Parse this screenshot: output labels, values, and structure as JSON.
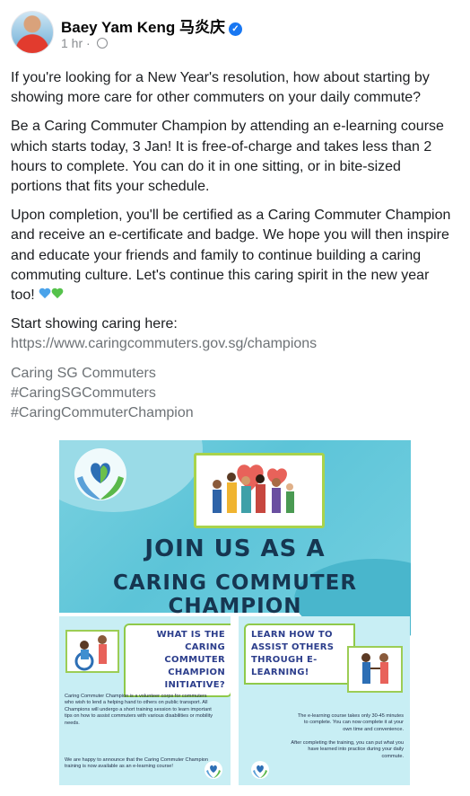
{
  "author": {
    "name": "Baey Yam Keng 马炎庆",
    "time": "1 hr ·"
  },
  "post": {
    "p1": "If you're looking for a New Year's resolution, how about starting by showing more care for other commuters on your daily commute?",
    "p2": "Be a Caring Commuter Champion by attending an e-learning course which starts today, 3 Jan! It is free-of-charge and takes less than 2 hours to complete. You can do it in one sitting, or in bite-sized portions that fits your schedule.",
    "p3": "Upon completion, you'll be certified as a Caring Commuter Champion and receive an e-certificate and badge. We hope you will then inspire and educate your friends and family to continue building a caring commuting culture. Let's continue this caring spirit in the new year too!",
    "p4_label": "Start showing caring here:",
    "p4_link": "https://www.caringcommuters.gov.sg/champions",
    "tags": [
      "Caring SG Commuters",
      "#CaringSGCommuters",
      "#CaringCommuterChampion"
    ]
  },
  "poster": {
    "line1": "JOIN US AS A",
    "line2": "CARING COMMUTER CHAMPION",
    "left": {
      "heading": "WHAT IS THE CARING COMMUTER CHAMPION INITIATIVE?",
      "text1": "Caring Commuter Champion is a volunteer corps for commuters who wish to lend a helping hand to others on public transport. All Champions will undergo a short training session to learn important tips on how to assist commuters with various disabilities or mobility needs.",
      "text2": "We are happy to announce that the Caring Commuter Champion training is now available as an e-learning course!"
    },
    "right": {
      "heading": "LEARN HOW TO ASSIST OTHERS THROUGH E-LEARNING!",
      "text1": "The e-learning course takes only 30-45 minutes to complete. You can now complete it at your own time and convenience.",
      "text2": "After completing the training, you can put what you have learned into practice during your daily commute."
    }
  },
  "colors": {
    "teal": "#5cc4d8",
    "navy": "#163651",
    "green": "#8fc94a",
    "link": "#6d7276"
  }
}
